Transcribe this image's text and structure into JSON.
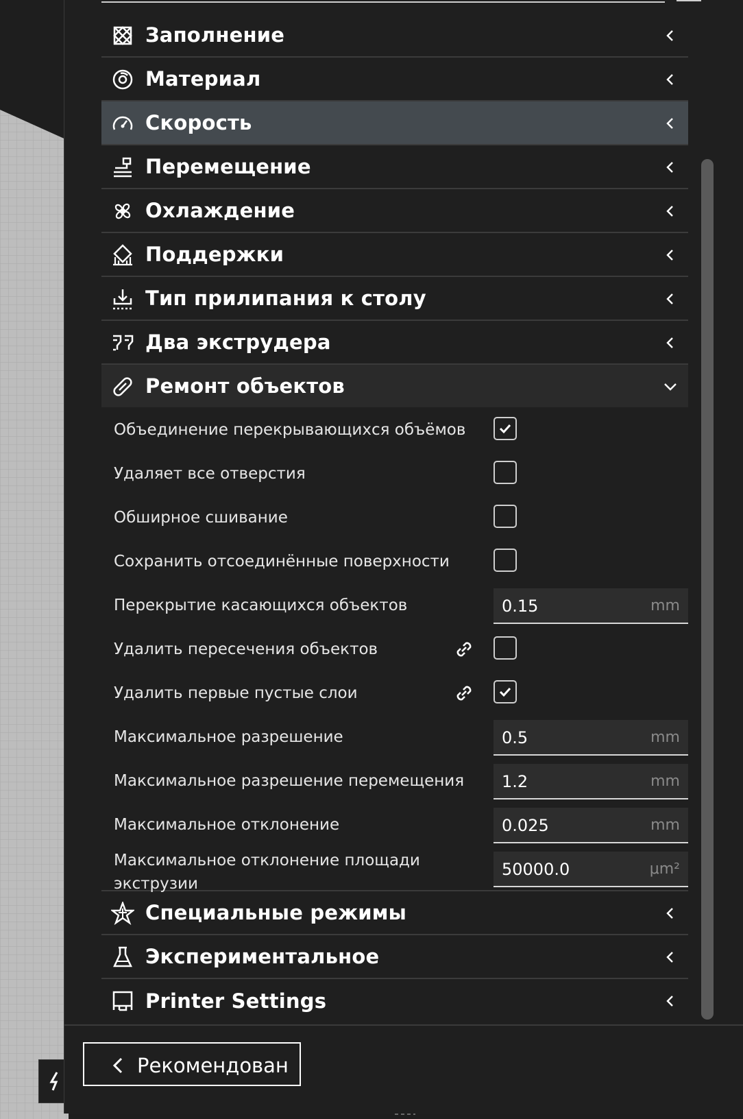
{
  "colors": {
    "panel_bg": "#1f1f1f",
    "highlight_bg": "#444a4f",
    "open_bg": "#2a2a2a",
    "separator": "#3b3b3b",
    "text": "#ffffff",
    "unit_text": "#8a8a8a"
  },
  "categories_top": [
    {
      "label": "Заполнение",
      "icon": "infill-icon"
    },
    {
      "label": "Материал",
      "icon": "material-icon"
    },
    {
      "label": "Скорость",
      "icon": "speed-icon",
      "highlighted": true
    },
    {
      "label": "Перемещение",
      "icon": "travel-icon"
    },
    {
      "label": "Охлаждение",
      "icon": "cooling-fan-icon"
    },
    {
      "label": "Поддержки",
      "icon": "support-icon"
    },
    {
      "label": "Тип прилипания к столу",
      "icon": "adhesion-icon"
    },
    {
      "label": "Два экструдера",
      "icon": "dual-extruder-icon"
    }
  ],
  "open_category": {
    "label": "Ремонт объектов",
    "icon": "mesh-fix-icon"
  },
  "settings": [
    {
      "label": "Объединение перекрывающихся объёмов",
      "type": "checkbox",
      "checked": true
    },
    {
      "label": "Удаляет все отверстия",
      "type": "checkbox",
      "checked": false
    },
    {
      "label": "Обширное сшивание",
      "type": "checkbox",
      "checked": false
    },
    {
      "label": "Сохранить отсоединённые поверхности",
      "type": "checkbox",
      "checked": false
    },
    {
      "label": "Перекрытие касающихся объектов",
      "type": "input",
      "value": "0.15",
      "unit": "mm"
    },
    {
      "label": "Удалить пересечения объектов",
      "type": "checkbox",
      "checked": false,
      "linked": true
    },
    {
      "label": "Удалить первые пустые слои",
      "type": "checkbox",
      "checked": true,
      "linked": true
    },
    {
      "label": "Максимальное разрешение",
      "type": "input",
      "value": "0.5",
      "unit": "mm"
    },
    {
      "label": "Максимальное разрешение перемещения",
      "type": "input",
      "value": "1.2",
      "unit": "mm"
    },
    {
      "label": "Максимальное отклонение",
      "type": "input",
      "value": "0.025",
      "unit": "mm"
    },
    {
      "label": "Максимальное отклонение площади экструзии",
      "type": "input",
      "value": "50000.0",
      "unit": "μm²"
    }
  ],
  "categories_bottom": [
    {
      "label": "Специальные режимы",
      "icon": "special-modes-icon"
    },
    {
      "label": "Экспериментальное",
      "icon": "experimental-flask-icon"
    },
    {
      "label": "Printer Settings",
      "icon": "printer-settings-icon"
    }
  ],
  "recommended_button": {
    "label": "Рекомендован",
    "icon": "chevron-left-icon"
  }
}
